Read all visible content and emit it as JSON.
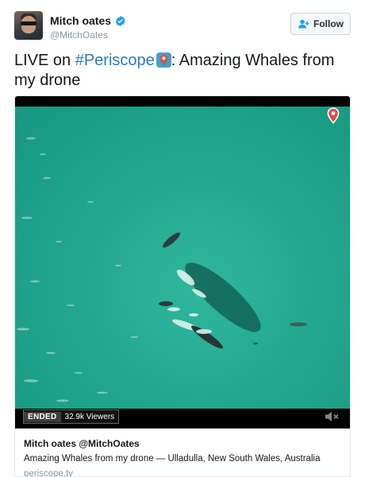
{
  "author": {
    "display_name": "Mitch oates",
    "handle": "@MitchOates",
    "verified": true
  },
  "follow_button": {
    "label": "Follow"
  },
  "tweet": {
    "text_prefix": "LIVE on ",
    "hashtag": "#Periscope",
    "text_suffix": ": Amazing Whales from my drone"
  },
  "video": {
    "status_label": "ENDED",
    "viewers_label": "32.9k Viewers",
    "icons": [
      "periscope-icon",
      "mute-icon"
    ]
  },
  "card": {
    "title": "Mitch oates @MitchOates",
    "description": "Amazing Whales from my drone — Ulladulla, New South Wales, Australia",
    "domain": "periscope.tv"
  },
  "colors": {
    "link": "#2b7bb9",
    "verified": "#1da1f2",
    "periscope_red": "#e04b4b",
    "periscope_blue": "#3fa4c4",
    "sea": "#22a88e"
  }
}
